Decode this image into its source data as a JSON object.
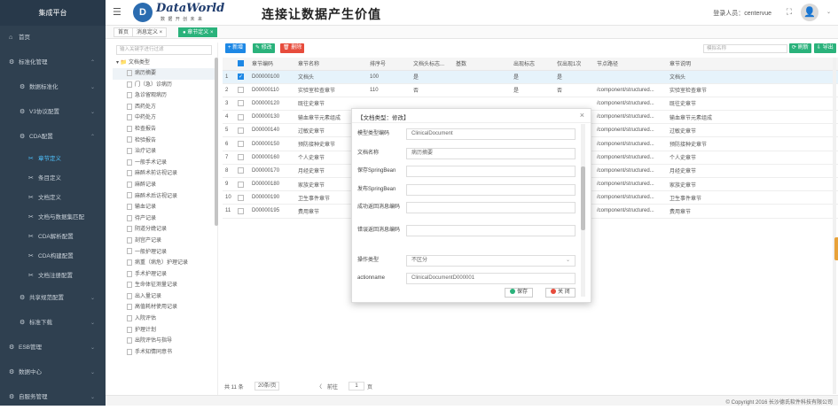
{
  "sidebar": {
    "brand": "集成平台",
    "items": [
      {
        "icon": "home-icon",
        "glyph": "⌂",
        "label": "首页",
        "level": 0,
        "chev": ""
      },
      {
        "icon": "gear-icon",
        "glyph": "⚙",
        "label": "标准化管理",
        "level": 0,
        "chev": "⌃"
      },
      {
        "icon": "gear-icon",
        "glyph": "⚙",
        "label": "数据标准化",
        "level": 1,
        "chev": "⌄"
      },
      {
        "icon": "gear-icon",
        "glyph": "⚙",
        "label": "V3协议配置",
        "level": 1,
        "chev": "⌄"
      },
      {
        "icon": "gear-icon",
        "glyph": "⚙",
        "label": "CDA配置",
        "level": 1,
        "chev": "⌃"
      },
      {
        "icon": "tool-icon",
        "glyph": "✂",
        "label": "章节定义",
        "level": 2,
        "chev": "",
        "active": true
      },
      {
        "icon": "tool-icon",
        "glyph": "✂",
        "label": "条目定义",
        "level": 2,
        "chev": ""
      },
      {
        "icon": "tool-icon",
        "glyph": "✂",
        "label": "文档定义",
        "level": 2,
        "chev": ""
      },
      {
        "icon": "tool-icon",
        "glyph": "✂",
        "label": "文档与数据集匹配",
        "level": 2,
        "chev": ""
      },
      {
        "icon": "tool-icon",
        "glyph": "✂",
        "label": "CDA解析配置",
        "level": 2,
        "chev": ""
      },
      {
        "icon": "tool-icon",
        "glyph": "✂",
        "label": "CDA构建配置",
        "level": 2,
        "chev": ""
      },
      {
        "icon": "tool-icon",
        "glyph": "✂",
        "label": "文档注册配置",
        "level": 2,
        "chev": ""
      },
      {
        "icon": "gear-icon",
        "glyph": "⚙",
        "label": "共享规范配置",
        "level": 1,
        "chev": "⌄"
      },
      {
        "icon": "gear-icon",
        "glyph": "⚙",
        "label": "标准下载",
        "level": 1,
        "chev": "⌄"
      },
      {
        "icon": "gear-icon",
        "glyph": "⚙",
        "label": "ESB管理",
        "level": 0,
        "chev": "⌄"
      },
      {
        "icon": "gear-icon",
        "glyph": "⚙",
        "label": "数据中心",
        "level": 0,
        "chev": "⌄"
      },
      {
        "icon": "gear-icon",
        "glyph": "⚙",
        "label": "自服务管理",
        "level": 0,
        "chev": "⌄"
      }
    ]
  },
  "header": {
    "logo_letter": "D",
    "logo_text": "DataWorld",
    "logo_sub": "数 据 开 创 未 来",
    "slogan": "连接让数据产生价值",
    "login_label": "登录人员：centervue",
    "fullscreen_glyph": "⛶",
    "avatar_glyph": "👤",
    "avatar_caret": "⌄"
  },
  "tabs": [
    {
      "label": "首页",
      "active": false
    },
    {
      "label": "消息定义 ×",
      "active": false
    },
    {
      "label": "● 章节定义 ×",
      "active": true
    }
  ],
  "tree": {
    "search_placeholder": "输入关键字进行过滤",
    "root": "▾ 📁 文档类型",
    "nodes": [
      "病历摘要",
      "门（急）诊病历",
      "急诊留观病历",
      "西药处方",
      "中药处方",
      "检查报告",
      "检验报告",
      "治疗记录",
      "一般手术记录",
      "麻醉术前访视记录",
      "麻醉记录",
      "麻醉术后访视记录",
      "输血记录",
      "待产记录",
      "阴道分娩记录",
      "剖宫产记录",
      "一般护理记录",
      "病重（病危）护理记录",
      "手术护理记录",
      "生命体征测量记录",
      "出入量记录",
      "高值耗材使用记录",
      "入院评估",
      "护理计划",
      "出院评估与指导",
      "手术知情同意书"
    ]
  },
  "toolbar": {
    "buttons": [
      {
        "label": "+ 新增",
        "color": "#1e88e5"
      },
      {
        "label": "✎ 修改",
        "color": "#2ab27b"
      },
      {
        "label": "🗑 删除",
        "color": "#e74c3c"
      }
    ],
    "search_placeholder": "模拟名称",
    "right_buttons": [
      {
        "label": "⟳ 刷新",
        "color": "#2ab27b"
      },
      {
        "label": "⇩ 导出",
        "color": "#2ab27b"
      }
    ]
  },
  "table": {
    "columns": [
      "",
      "",
      "章节编码",
      "章节名称",
      "排序号",
      "文档头标志...",
      "基数",
      "出现标志",
      "仅出现1次",
      "节点路径",
      "章节说明"
    ],
    "rows": [
      [
        "1",
        "✓",
        "D00000100",
        "文档头",
        "100",
        "是",
        "",
        "是",
        "是",
        "",
        "文档头"
      ],
      [
        "2",
        "",
        "D00000110",
        "实验室检查章节",
        "110",
        "否",
        "",
        "是",
        "否",
        "/component/structured...",
        "实验室检查章节"
      ],
      [
        "3",
        "",
        "D00000120",
        "既往史章节",
        "",
        "",
        "",
        "",
        "",
        "/component/structured...",
        "既往史章节"
      ],
      [
        "4",
        "",
        "D00000130",
        "输血章节元素组成",
        "",
        "",
        "",
        "",
        "",
        "/component/structured...",
        "输血章节元素组成"
      ],
      [
        "5",
        "",
        "D00000140",
        "过敏史章节",
        "",
        "",
        "",
        "",
        "",
        "/component/structured...",
        "过敏史章节"
      ],
      [
        "6",
        "",
        "D00000150",
        "预防接种史章节",
        "",
        "",
        "",
        "",
        "",
        "/component/structured...",
        "预防接种史章节"
      ],
      [
        "7",
        "",
        "D00000160",
        "个人史章节",
        "",
        "",
        "",
        "",
        "",
        "/component/structured...",
        "个人史章节"
      ],
      [
        "8",
        "",
        "D00000170",
        "月经史章节",
        "",
        "",
        "",
        "",
        "",
        "/component/structured...",
        "月经史章节"
      ],
      [
        "9",
        "",
        "D00000180",
        "家族史章节",
        "",
        "",
        "",
        "",
        "",
        "/component/structured...",
        "家族史章节"
      ],
      [
        "10",
        "",
        "D00000190",
        "卫生事件章节",
        "",
        "",
        "",
        "",
        "",
        "/component/structured...",
        "卫生事件章节"
      ],
      [
        "11",
        "",
        "D00000195",
        "费用章节",
        "",
        "",
        "",
        "",
        "",
        "/component/structured...",
        "费用章节"
      ]
    ]
  },
  "pager": {
    "total": "共 11 条",
    "page_size": "20条/页",
    "prev": "〈",
    "next": "〉",
    "goto": "前往",
    "page": "1",
    "page_suffix": "页"
  },
  "modal": {
    "title": "【文档类型：修改】",
    "close": "×",
    "fields": [
      {
        "label": "模型类型编码",
        "value": "ClinicalDocument",
        "select": false
      },
      {
        "label": "文档名称",
        "value": "病历摘要",
        "select": false
      },
      {
        "label": "保存SpringBean",
        "value": "",
        "select": false
      },
      {
        "label": "发布SpringBean",
        "value": "",
        "select": false
      },
      {
        "label": "成功返回消息编码",
        "value": "",
        "select": false
      },
      {
        "label": "错误返回消息编码",
        "value": "",
        "select": false
      },
      {
        "label": "操作类型",
        "value": "不区分",
        "select": true
      },
      {
        "label": "actionname",
        "value": "ClinicalDocumentD000001",
        "select": false
      }
    ],
    "save_label": "保存",
    "close_label": "关 闭"
  },
  "footer": {
    "copyright": "© Copyright 2016 长沙德氏软件科技有限公司"
  },
  "colors": {
    "sidebar": "#2f4050",
    "primary": "#1e88e5",
    "success": "#2ab27b",
    "danger": "#e74c3c"
  }
}
